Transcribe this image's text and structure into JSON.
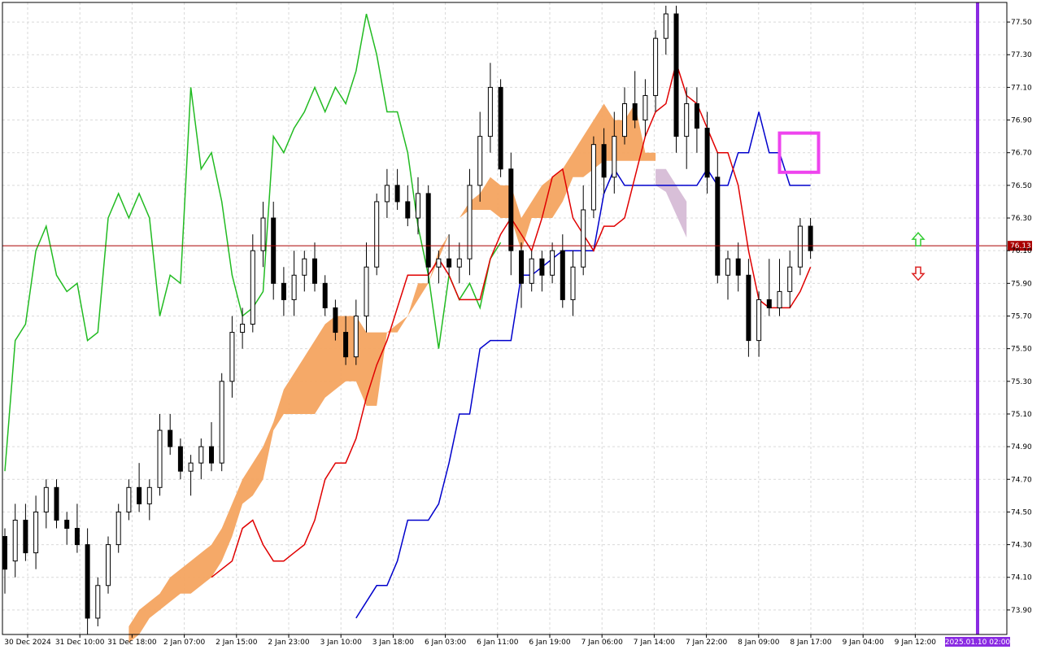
{
  "chart_data": {
    "type": "candlestick-ichimoku",
    "y_axis": {
      "range": [
        73.75,
        77.62
      ],
      "ticks": [
        "73.90",
        "74.10",
        "74.30",
        "74.50",
        "74.70",
        "74.90",
        "75.10",
        "75.30",
        "75.50",
        "75.70",
        "75.90",
        "76.10",
        "76.30",
        "76.50",
        "76.70",
        "76.90",
        "77.10",
        "77.30",
        "77.50"
      ]
    },
    "x_axis": {
      "labels": [
        "30 Dec 2024",
        "31 Dec 10:00",
        "31 Dec 18:00",
        "2 Jan 07:00",
        "2 Jan 15:00",
        "2 Jan 23:00",
        "3 Jan 10:00",
        "3 Jan 18:00",
        "6 Jan 03:00",
        "6 Jan 11:00",
        "6 Jan 19:00",
        "7 Jan 06:00",
        "7 Jan 14:00",
        "7 Jan 22:00",
        "8 Jan 09:00",
        "8 Jan 17:00",
        "9 Jan 04:00",
        "9 Jan 12:00"
      ]
    },
    "grid": true,
    "current_price": "76.13",
    "vertical_marker_label": "2025.01.10 02:00",
    "colors": {
      "tenkan": "#e00000",
      "kijun": "#0000cc",
      "chikou": "#22bb22",
      "cloud_bull": "#f4a460",
      "cloud_bear": "#d8bfd8",
      "price_line": "#aa0000",
      "highlight_box": "#ee44ee",
      "vertical_marker": "#8a2be2",
      "up_arrow": "#33cc33",
      "down_arrow": "#dd2222"
    },
    "candles": [
      [
        74.35,
        74.4,
        74.0,
        74.15
      ],
      [
        74.2,
        74.55,
        74.1,
        74.45
      ],
      [
        74.45,
        74.55,
        74.2,
        74.25
      ],
      [
        74.25,
        74.6,
        74.15,
        74.5
      ],
      [
        74.5,
        74.7,
        74.4,
        74.65
      ],
      [
        74.65,
        74.7,
        74.4,
        74.45
      ],
      [
        74.45,
        74.5,
        74.3,
        74.4
      ],
      [
        74.4,
        74.55,
        74.25,
        74.3
      ],
      [
        74.3,
        74.4,
        73.75,
        73.85
      ],
      [
        73.85,
        74.1,
        73.8,
        74.05
      ],
      [
        74.05,
        74.35,
        74.0,
        74.3
      ],
      [
        74.3,
        74.55,
        74.25,
        74.5
      ],
      [
        74.5,
        74.7,
        74.45,
        74.65
      ],
      [
        74.65,
        74.8,
        74.5,
        74.55
      ],
      [
        74.55,
        74.7,
        74.45,
        74.65
      ],
      [
        74.65,
        75.1,
        74.6,
        75.0
      ],
      [
        75.0,
        75.1,
        74.85,
        74.9
      ],
      [
        74.9,
        74.95,
        74.7,
        74.75
      ],
      [
        74.75,
        74.85,
        74.6,
        74.8
      ],
      [
        74.8,
        74.95,
        74.7,
        74.9
      ],
      [
        74.9,
        75.05,
        74.75,
        74.8
      ],
      [
        74.8,
        75.35,
        74.75,
        75.3
      ],
      [
        75.3,
        75.7,
        75.2,
        75.6
      ],
      [
        75.6,
        75.75,
        75.5,
        75.65
      ],
      [
        75.65,
        76.2,
        75.6,
        76.1
      ],
      [
        76.1,
        76.4,
        76.0,
        76.3
      ],
      [
        76.3,
        76.4,
        75.8,
        75.9
      ],
      [
        75.9,
        76.0,
        75.7,
        75.8
      ],
      [
        75.8,
        76.1,
        75.7,
        75.95
      ],
      [
        75.95,
        76.1,
        75.85,
        76.05
      ],
      [
        76.05,
        76.15,
        75.85,
        75.9
      ],
      [
        75.9,
        75.95,
        75.7,
        75.75
      ],
      [
        75.75,
        75.8,
        75.55,
        75.6
      ],
      [
        75.6,
        75.7,
        75.4,
        75.45
      ],
      [
        75.45,
        75.8,
        75.4,
        75.7
      ],
      [
        75.7,
        76.15,
        75.6,
        76.0
      ],
      [
        76.0,
        76.45,
        75.95,
        76.4
      ],
      [
        76.4,
        76.6,
        76.3,
        76.5
      ],
      [
        76.5,
        76.6,
        76.35,
        76.4
      ],
      [
        76.4,
        76.5,
        76.25,
        76.3
      ],
      [
        76.3,
        76.55,
        76.2,
        76.45
      ],
      [
        76.45,
        76.5,
        75.9,
        76.0
      ],
      [
        76.0,
        76.1,
        75.9,
        76.05
      ],
      [
        76.05,
        76.2,
        75.95,
        76.0
      ],
      [
        76.0,
        76.15,
        75.9,
        76.05
      ],
      [
        76.05,
        76.6,
        75.95,
        76.5
      ],
      [
        76.5,
        76.95,
        76.4,
        76.8
      ],
      [
        76.8,
        77.25,
        76.7,
        77.1
      ],
      [
        77.1,
        77.15,
        76.55,
        76.6
      ],
      [
        76.6,
        76.7,
        75.95,
        76.1
      ],
      [
        76.1,
        76.15,
        75.75,
        75.9
      ],
      [
        75.9,
        76.1,
        75.85,
        76.05
      ],
      [
        76.05,
        76.1,
        75.85,
        75.95
      ],
      [
        75.95,
        76.15,
        75.9,
        76.1
      ],
      [
        76.1,
        76.2,
        75.75,
        75.8
      ],
      [
        75.8,
        76.1,
        75.7,
        76.0
      ],
      [
        76.0,
        76.5,
        75.95,
        76.35
      ],
      [
        76.35,
        76.8,
        76.3,
        76.75
      ],
      [
        76.75,
        76.85,
        76.45,
        76.55
      ],
      [
        76.55,
        76.95,
        76.45,
        76.8
      ],
      [
        76.8,
        77.1,
        76.75,
        77.0
      ],
      [
        77.0,
        77.2,
        76.85,
        76.9
      ],
      [
        76.9,
        77.15,
        76.8,
        77.05
      ],
      [
        77.05,
        77.45,
        76.95,
        77.4
      ],
      [
        77.4,
        77.6,
        77.3,
        77.55
      ],
      [
        77.55,
        77.6,
        76.7,
        76.8
      ],
      [
        76.8,
        77.1,
        76.6,
        77.0
      ],
      [
        77.0,
        77.1,
        76.7,
        76.85
      ],
      [
        76.85,
        76.95,
        76.45,
        76.55
      ],
      [
        76.55,
        76.7,
        75.9,
        75.95
      ],
      [
        75.95,
        76.1,
        75.8,
        76.05
      ],
      [
        76.05,
        76.15,
        75.85,
        75.95
      ],
      [
        75.95,
        76.05,
        75.45,
        75.55
      ],
      [
        75.55,
        75.85,
        75.45,
        75.8
      ],
      [
        75.8,
        76.05,
        75.7,
        75.75
      ],
      [
        75.75,
        76.05,
        75.7,
        75.85
      ],
      [
        75.85,
        76.1,
        75.75,
        76.0
      ],
      [
        76.0,
        76.3,
        75.95,
        76.25
      ],
      [
        76.25,
        76.3,
        76.05,
        76.1
      ]
    ],
    "tenkan": [
      74.1,
      74.15,
      74.2,
      74.4,
      74.45,
      74.3,
      74.2,
      74.2,
      74.25,
      74.3,
      74.45,
      74.7,
      74.8,
      74.8,
      74.95,
      75.2,
      75.4,
      75.55,
      75.75,
      75.95,
      75.95,
      75.95,
      76.05,
      75.95,
      75.8,
      75.8,
      75.8,
      76.05,
      76.2,
      76.3,
      76.2,
      76.1,
      76.3,
      76.55,
      76.6,
      76.3,
      76.2,
      76.1,
      76.25,
      76.25,
      76.3,
      76.55,
      76.8,
      76.95,
      77.0,
      77.25,
      77.05,
      77.0,
      76.85,
      76.7,
      76.7,
      76.5,
      76.1,
      75.8,
      75.75,
      75.75,
      75.75,
      75.85,
      76.0
    ],
    "kijun": [
      73.85,
      73.95,
      74.05,
      74.05,
      74.2,
      74.45,
      74.45,
      74.45,
      74.55,
      74.8,
      75.1,
      75.1,
      75.5,
      75.55,
      75.55,
      75.55,
      75.95,
      75.95,
      76.0,
      76.05,
      76.1,
      76.1,
      76.1,
      76.1,
      76.45,
      76.6,
      76.5,
      76.5,
      76.5,
      76.5,
      76.5,
      76.5,
      76.5,
      76.5,
      76.6,
      76.5,
      76.5,
      76.7,
      76.7,
      76.95,
      76.7,
      76.7,
      76.5,
      76.5,
      76.5
    ],
    "chikou": [
      74.75,
      75.55,
      75.65,
      76.1,
      76.25,
      75.95,
      75.85,
      75.9,
      75.55,
      75.6,
      76.3,
      76.45,
      76.3,
      76.45,
      76.3,
      75.7,
      75.95,
      75.9,
      77.1,
      76.6,
      76.7,
      76.4,
      75.95,
      75.7,
      75.75,
      75.85,
      76.8,
      76.7,
      76.85,
      76.95,
      77.1,
      76.95,
      77.1,
      77.0,
      77.2,
      77.55,
      77.3,
      76.95,
      76.95,
      76.7,
      76.25,
      75.95,
      75.5,
      75.95,
      75.8,
      75.9,
      75.75,
      76.05,
      76.15
    ],
    "cloud_a": [
      73.8,
      73.9,
      73.95,
      74.0,
      74.1,
      74.15,
      74.2,
      74.25,
      74.3,
      74.4,
      74.55,
      74.7,
      74.8,
      74.9,
      75.05,
      75.25,
      75.35,
      75.45,
      75.55,
      75.65,
      75.7,
      75.7,
      75.7,
      75.6,
      75.6,
      75.6,
      75.6,
      75.7,
      75.9,
      75.9,
      76.1,
      76.2,
      76.3,
      76.4,
      76.45,
      76.55,
      76.5,
      76.5,
      76.3,
      76.4,
      76.5,
      76.55,
      76.6,
      76.7,
      76.8,
      76.9,
      77.0,
      76.9,
      76.9,
      77.0,
      76.7,
      76.7
    ],
    "cloud_b": [
      73.7,
      73.75,
      73.85,
      73.9,
      73.95,
      74.0,
      74.0,
      74.05,
      74.1,
      74.2,
      74.35,
      74.55,
      74.6,
      74.7,
      75.0,
      75.1,
      75.1,
      75.1,
      75.1,
      75.2,
      75.25,
      75.3,
      75.3,
      75.15,
      75.15,
      75.6,
      75.65,
      75.7,
      75.8,
      75.9,
      76.05,
      76.2,
      76.3,
      76.35,
      76.35,
      76.35,
      76.3,
      76.3,
      76.1,
      76.3,
      76.3,
      76.3,
      76.4,
      76.55,
      76.55,
      76.6,
      76.65,
      76.65,
      76.65,
      76.65,
      76.65,
      76.65
    ],
    "future_cloud": [
      76.6,
      76.6,
      76.5,
      76.4
    ]
  }
}
